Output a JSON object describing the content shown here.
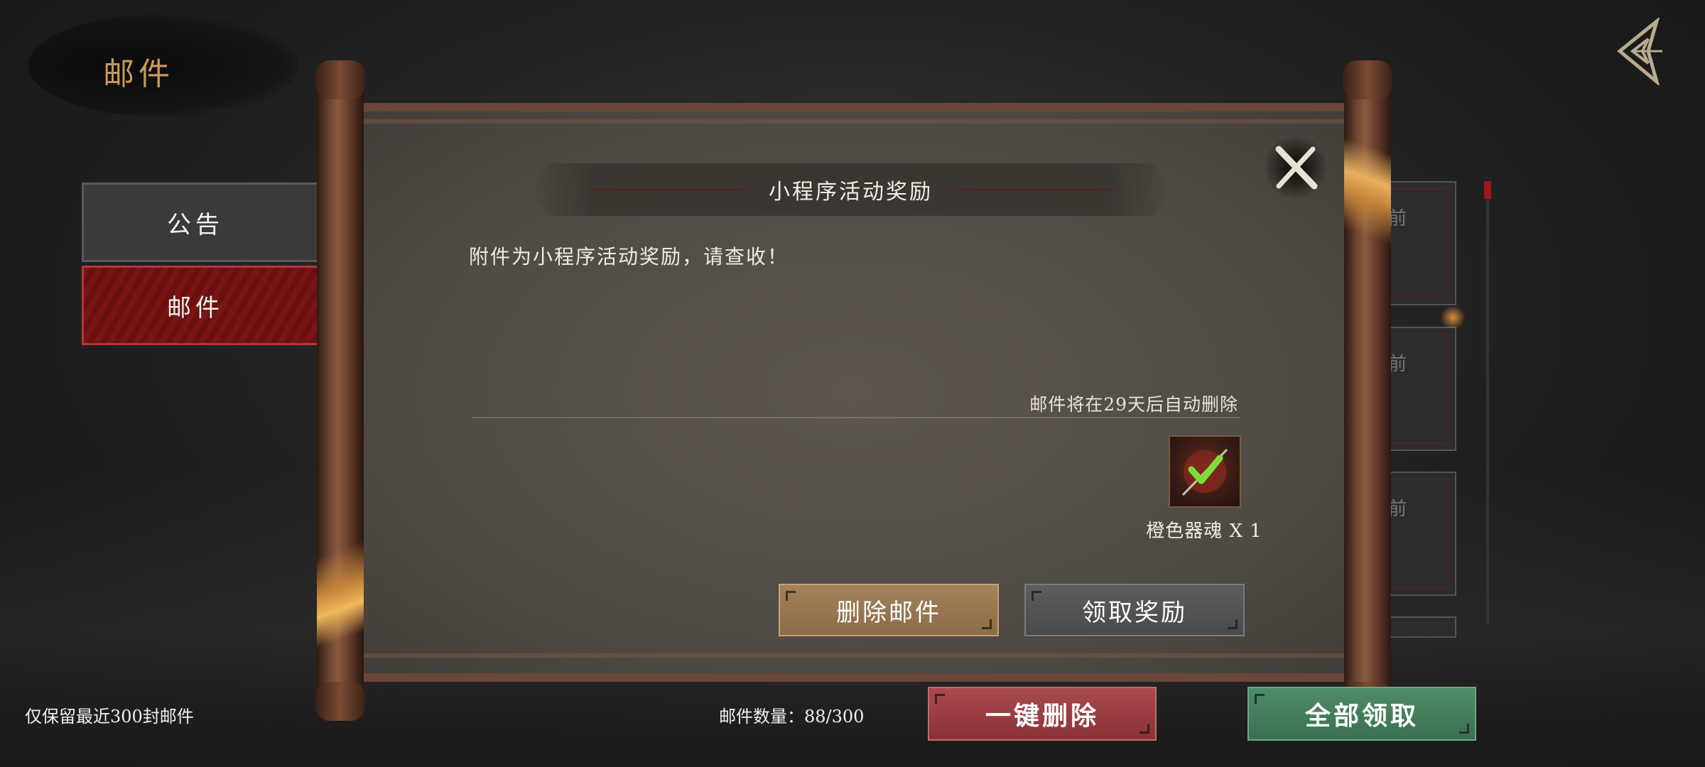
{
  "page": {
    "title": "邮件"
  },
  "tabs": [
    {
      "label": "公告",
      "active": false
    },
    {
      "label": "邮件",
      "active": true
    }
  ],
  "mail_list": {
    "partial_tag": "前"
  },
  "mail": {
    "title": "小程序活动奖励",
    "body": "附件为小程序活动奖励，请查收！",
    "expire_notice": "邮件将在29天后自动删除",
    "attachment": {
      "icon": "orange-soul-artifact-icon",
      "label": "橙色器魂 X 1"
    },
    "delete_button": "删除邮件",
    "claim_button": "领取奖励"
  },
  "footer": {
    "retention_note": "仅保留最近300封邮件",
    "count_label": "邮件数量：88/300",
    "delete_all_button": "一键删除",
    "claim_all_button": "全部领取"
  },
  "colors": {
    "accent_gold": "#c99a5b",
    "active_tab_red": "#7a1515",
    "delete_all_red": "#a94a4e",
    "claim_all_green": "#4e8c68",
    "delete_btn_tan": "#a2835a",
    "claim_btn_gray": "#5d5d5d"
  }
}
